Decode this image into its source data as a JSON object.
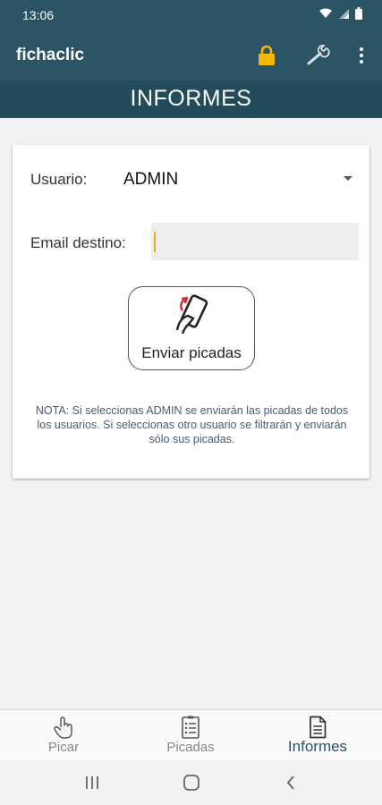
{
  "status_bar": {
    "time": "13:06"
  },
  "app_bar": {
    "title": "fichaclic"
  },
  "section": {
    "title": "INFORMES"
  },
  "form": {
    "user_label": "Usuario:",
    "user_value": "ADMIN",
    "email_label": "Email destino:",
    "email_value": "",
    "send_button_label": "Enviar picadas",
    "note": "NOTA: Si seleccionas ADMIN se enviarán las picadas de todos los usuarios. Si seleccionas otro usuario se filtrarán y enviarán sólo sus picadas."
  },
  "bottom_nav": {
    "items": [
      {
        "label": "Picar",
        "icon": "hand-pointer-icon"
      },
      {
        "label": "Picadas",
        "icon": "checklist-icon"
      },
      {
        "label": "Informes",
        "icon": "document-icon",
        "active": true
      }
    ]
  },
  "colors": {
    "primary": "#2b5465",
    "header": "#224c5c",
    "accent": "#f3a91b",
    "lock": "#f5b800"
  }
}
